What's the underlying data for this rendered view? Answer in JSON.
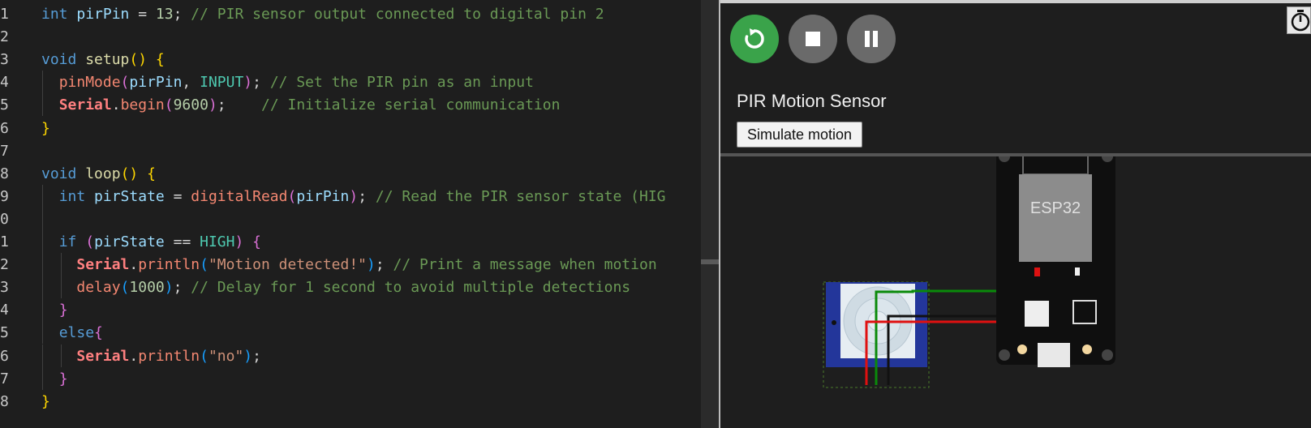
{
  "editor": {
    "lines": [
      {
        "n": "1",
        "html": "<span class='kw'>int</span> <span class='var'>pirPin</span> = <span class='num'>13</span>; <span class='cmt'>// PIR sensor output connected to digital pin 2</span>",
        "indent": 0
      },
      {
        "n": "2",
        "html": "",
        "indent": 0
      },
      {
        "n": "3",
        "html": "<span class='kw'>void</span> <span class='fn'>setup</span><span class='p1'>()</span> <span class='p1'>{</span>",
        "indent": 0
      },
      {
        "n": "4",
        "html": "  <span class='fn2'>pinMode</span><span class='p2'>(</span><span class='var'>pirPin</span>, <span class='const'>INPUT</span><span class='p2'>)</span>; <span class='cmt'>// Set the PIR pin as an input</span>",
        "indent": 1
      },
      {
        "n": "5",
        "html": "  <span class='cls'>Serial</span>.<span class='fn2'>begin</span><span class='p2'>(</span><span class='num'>9600</span><span class='p2'>)</span>;    <span class='cmt'>// Initialize serial communication</span>",
        "indent": 1
      },
      {
        "n": "6",
        "html": "<span class='p1'>}</span>",
        "indent": 0
      },
      {
        "n": "7",
        "html": "",
        "indent": 0
      },
      {
        "n": "8",
        "html": "<span class='kw'>void</span> <span class='fn'>loop</span><span class='p1'>()</span> <span class='p1'>{</span>",
        "indent": 0
      },
      {
        "n": "9",
        "html": "  <span class='kw'>int</span> <span class='var'>pirState</span> = <span class='fn2'>digitalRead</span><span class='p2'>(</span><span class='var'>pirPin</span><span class='p2'>)</span>; <span class='cmt'>// Read the PIR sensor state (HIG</span>",
        "indent": 1
      },
      {
        "n": "0",
        "html": "",
        "indent": 1
      },
      {
        "n": "1",
        "html": "  <span class='kw'>if</span> <span class='p2'>(</span><span class='var'>pirState</span> == <span class='const'>HIGH</span><span class='p2'>)</span> <span class='p2'>{</span>",
        "indent": 1
      },
      {
        "n": "2",
        "html": "    <span class='cls'>Serial</span>.<span class='fn2'>println</span><span class='p3'>(</span><span class='str'>\"Motion detected!\"</span><span class='p3'>)</span>; <span class='cmt'>// Print a message when motion</span>",
        "indent": 2
      },
      {
        "n": "3",
        "html": "    <span class='fn2'>delay</span><span class='p3'>(</span><span class='num'>1000</span><span class='p3'>)</span>; <span class='cmt'>// Delay for 1 second to avoid multiple detections</span>",
        "indent": 2
      },
      {
        "n": "4",
        "html": "  <span class='p2'>}</span>",
        "indent": 1
      },
      {
        "n": "5",
        "html": "  <span class='kw'>else</span><span class='p2'>{</span>",
        "indent": 1
      },
      {
        "n": "6",
        "html": "    <span class='cls'>Serial</span>.<span class='fn2'>println</span><span class='p3'>(</span><span class='str'>\"no\"</span><span class='p3'>)</span>;",
        "indent": 2
      },
      {
        "n": "7",
        "html": "  <span class='p2'>}</span>",
        "indent": 1
      },
      {
        "n": "8",
        "html": "<span class='p1'>}</span>",
        "indent": 0
      }
    ]
  },
  "sim": {
    "title": "PIR Motion Sensor",
    "simulate_button": "Simulate motion",
    "board_label": "ESP32",
    "restart_icon": "restart-icon",
    "stop_icon": "stop-icon",
    "pause_icon": "pause-icon",
    "timer_icon": "timer-icon",
    "colors": {
      "green": "#3aa34a",
      "wire_green": "#0a8a0a",
      "wire_red": "#e01010",
      "wire_black": "#111111"
    }
  }
}
